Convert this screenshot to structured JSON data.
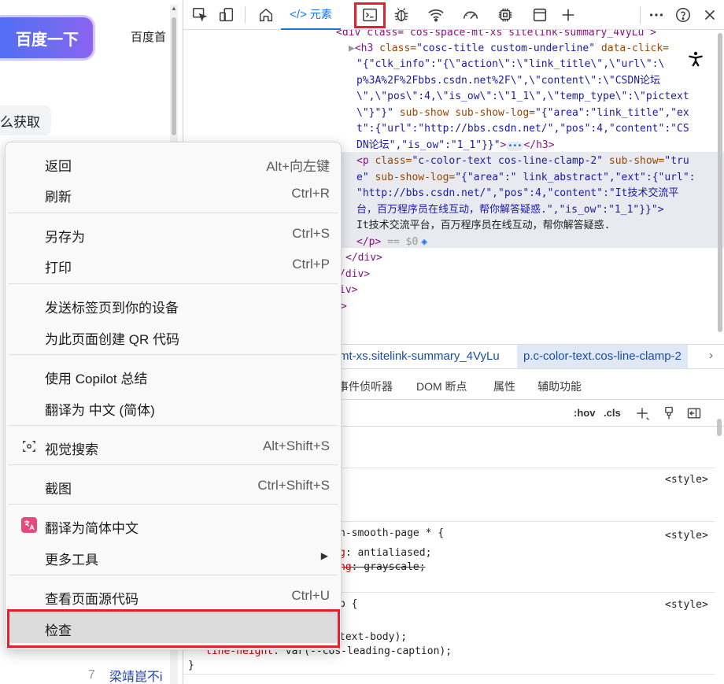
{
  "page": {
    "search_button": "百度一下",
    "homepage_link": "百度首",
    "chip_text": "么获取",
    "rank_number": "7",
    "rank_title": "梁靖崑不i"
  },
  "devtools": {
    "toolbar": {
      "icons": [
        "inspect-element-icon",
        "device-emulation-icon",
        "welcome-home-icon",
        "elements-icon",
        "console-icon",
        "sources-bug-icon",
        "network-wifi-icon",
        "performance-gauge-icon",
        "memory-chip-icon",
        "application-panel-icon",
        "add-panel-icon",
        "more-options-icon",
        "help-icon",
        "close-icon"
      ],
      "elements_tab_code": "</>",
      "elements_tab_label": "元素"
    },
    "dom_tree": {
      "line0": "<div class= cos-space-mt-xs sitelink-summary_4VyLu >",
      "h3_open": "<h3",
      "h3_class_attr": " class=",
      "h3_class_val": "\"cosc-title custom-underline\"",
      "h3_dataclick_attr": " data-click=",
      "h3_val_1": "\"{\"clk_info\":\"{\\\"action\\\":\\\"link_title\\\",\\\"url\\\":\\",
      "h3_val_2": "p%3A%2F%2Fbbs.csdn.net%2F\\\",\\\"content\\\":\\\"CSDN论坛",
      "h3_val_3": "\\\",\\\"pos\\\":4,\\\"is_ow\\\":\\\"1_1\\\",\\\"temp_type\\\":\\\"pictext",
      "h3_val_4_end": "\\\"}\"}\"",
      "h3_subshow": " sub-show sub-show-log=",
      "h3_subshow_val": "\"{\"area\":\"link_title\",\"ex",
      "h3_val_5": "t\":{\"url\":\"http://bbs.csdn.net/\",\"pos\":4,\"content\":\"CS",
      "h3_val_6": "DN论坛\",\"is_ow\":\"1_1\"}}\"",
      "h3_close": "</h3>",
      "p_open": "<p",
      "p_class_attr": " class=",
      "p_class_val": "\"c-color-text cos-line-clamp-2\"",
      "p_subshow_attr": " sub-show=",
      "p_subshow_val_1": "\"tru",
      "p_subshow_val_2": "e\"",
      "p_subshowlog_attr": " sub-show-log=",
      "p_subshowlog_val_1": "\"{\"area\":\" link_abstract\",\"ext\":{\"url\":",
      "p_val_2": "\"http://bbs.csdn.net/\",\"pos\":4,\"content\":\"It技术交流平",
      "p_val_3": "台，百万程序员在线互动，帮你解答疑惑.\",\"is_ow\":\"1_1\"}}\">",
      "p_text": "It技术交流平台，百万程序员在线互动，帮你解答疑惑.",
      "p_close": "</p>",
      "p_eq": " == $0",
      "div_close_1": "</div>",
      "div_close_2": "/div>",
      "div_close_3": "iv>",
      "gt": ">"
    },
    "breadcrumb": {
      "crumb1": "mt-xs.sitelink-summary_4VyLu",
      "crumb2": "p.c-color-text.cos-line-clamp-2"
    },
    "sub_tabs": [
      "事件侦听器",
      "DOM 断点",
      "属性",
      "辅助功能"
    ],
    "filter": {
      "hov": ":hov",
      "cls": ".cls"
    },
    "styles": {
      "src": "<style>",
      "rule2_selector": "h-smooth-page * {",
      "rule2_p1_name": "g",
      "rule2_p1_val": ": antialiased;",
      "rule2_p2_name": "ng",
      "rule2_p2_val": ": grayscale;",
      "rule3_selector": "p {",
      "rule3_p1_val": "text-body);",
      "rule3_p2_name": "line-height",
      "rule3_p2_val": ": var(--cos-leading-caption);",
      "close_brace": "}"
    }
  },
  "context_menu": {
    "back": {
      "label": "返回",
      "shortcut": "Alt+向左键"
    },
    "refresh": {
      "label": "刷新",
      "shortcut": "Ctrl+R"
    },
    "save_as": {
      "label": "另存为",
      "shortcut": "Ctrl+S"
    },
    "print": {
      "label": "打印",
      "shortcut": "Ctrl+P"
    },
    "send_tab": {
      "label": "发送标签页到你的设备"
    },
    "qr_code": {
      "label": "为此页面创建 QR 代码"
    },
    "copilot": {
      "label": "使用 Copilot 总结"
    },
    "translate_to": {
      "label": "翻译为 中文 (简体)"
    },
    "visual_search": {
      "label": "视觉搜索",
      "shortcut": "Alt+Shift+S",
      "icon": "visual-search-icon"
    },
    "screenshot": {
      "label": "截图",
      "shortcut": "Ctrl+Shift+S"
    },
    "translate_simplified": {
      "label": "翻译为简体中文",
      "icon": "translate-icon"
    },
    "more_tools": {
      "label": "更多工具"
    },
    "view_source": {
      "label": "查看页面源代码",
      "shortcut": "Ctrl+U"
    },
    "inspect": {
      "label": "检查"
    }
  },
  "colors": {
    "highlight_red": "#e5202b",
    "accent_blue": "#1a73e8",
    "baidu_blue": "#4e6ef2"
  }
}
